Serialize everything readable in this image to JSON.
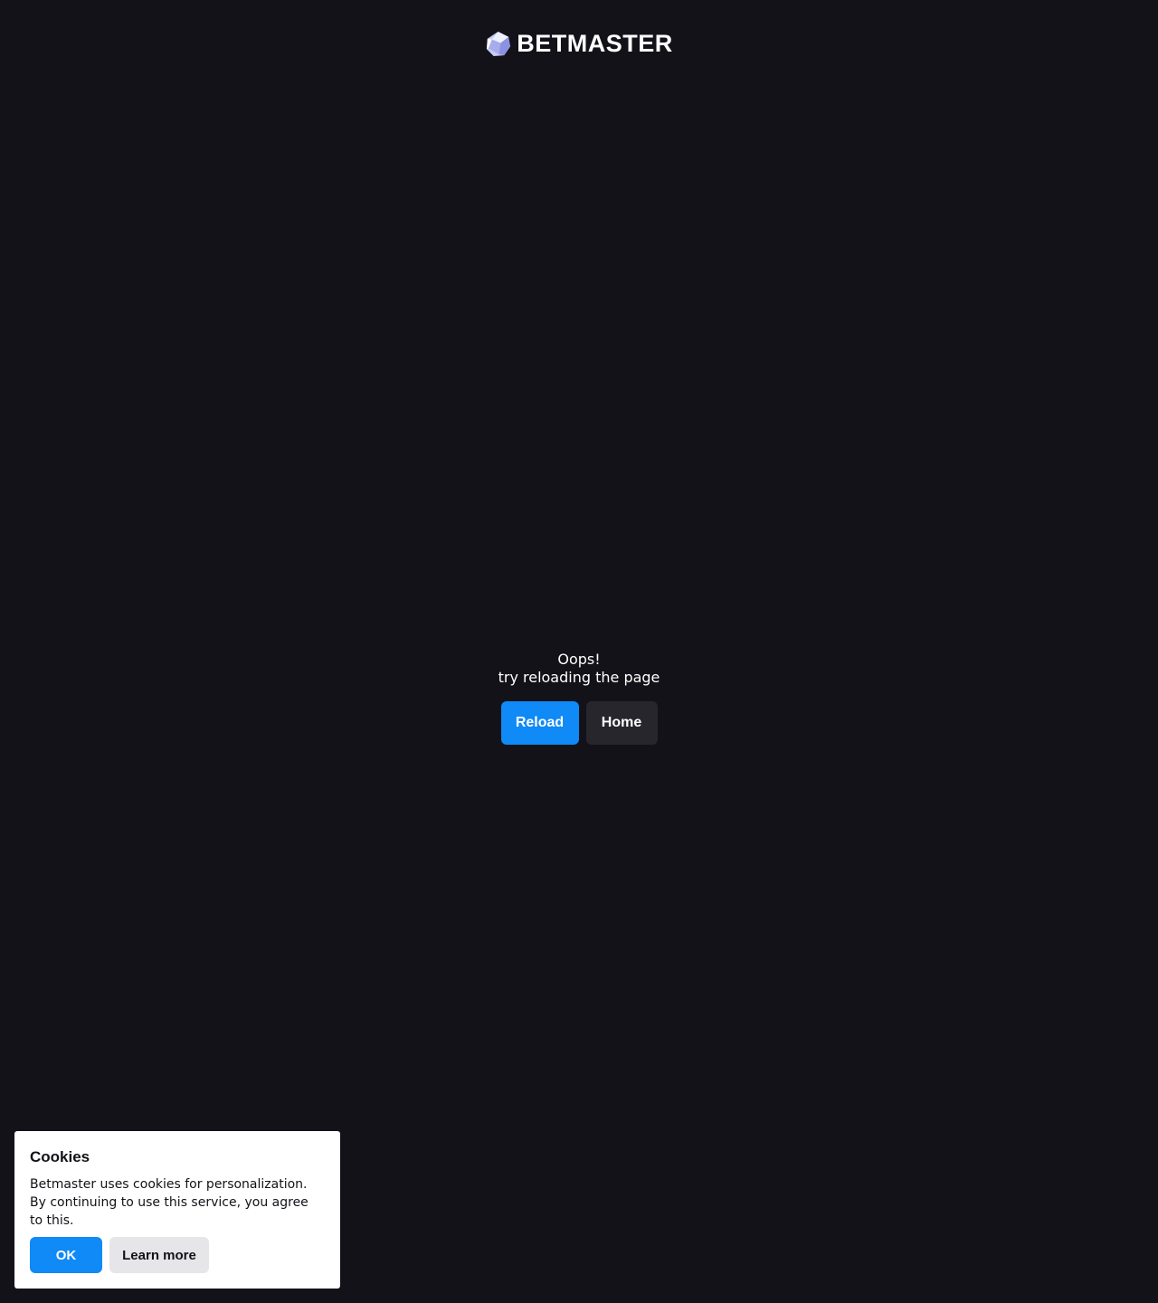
{
  "header": {
    "logo_text": "BETMASTER",
    "logo_icon": "betmaster-logo-icon"
  },
  "error": {
    "title": "Oops!",
    "message": "try reloading the page",
    "reload_label": "Reload",
    "home_label": "Home"
  },
  "cookies": {
    "title": "Cookies",
    "text": "Betmaster uses cookies for personalization. By continuing to use this service, you agree to this.",
    "ok_label": "OK",
    "learn_more_label": "Learn more"
  },
  "colors": {
    "background": "#131218",
    "accent": "#0f8af7",
    "secondary_button": "#27262c",
    "cookie_panel": "#ffffff"
  }
}
